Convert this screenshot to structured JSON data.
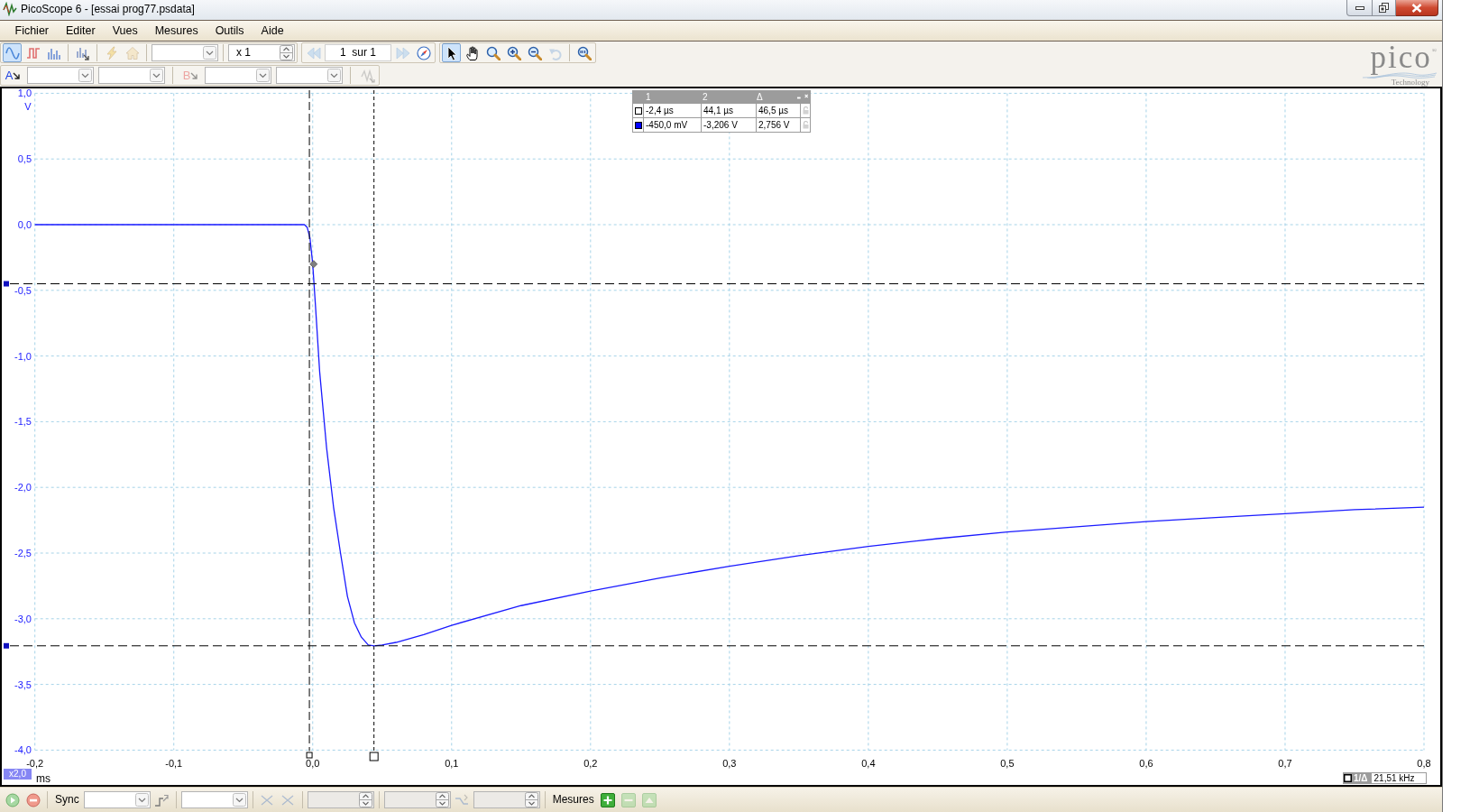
{
  "window": {
    "title": "PicoScope 6 - [essai prog77.psdata]"
  },
  "menu": [
    "Fichier",
    "Editer",
    "Vues",
    "Mesures",
    "Outils",
    "Aide"
  ],
  "toolbar_top": [
    [
      [
        {
          "kind": "button",
          "selected": true,
          "disabled": false
        },
        {
          "kind": "button",
          "selected": false,
          "disabled": false
        },
        {
          "kind": "button",
          "selected": false,
          "disabled": false
        }
      ],
      [
        {
          "kind": "button",
          "selected": false,
          "disabled": false
        }
      ],
      [
        {
          "kind": "button",
          "selected": false,
          "disabled": true
        },
        {
          "kind": "button",
          "selected": false,
          "disabled": true
        }
      ],
      [
        {
          "kind": "combo",
          "disabled": false
        }
      ],
      [
        {
          "kind": "spin",
          "value": "x 1",
          "disabled": false
        }
      ]
    ],
    [
      [
        {
          "kind": "button",
          "selected": false,
          "disabled": true
        },
        {
          "kind": "field",
          "value": "1  sur 1"
        },
        {
          "kind": "button",
          "selected": false,
          "disabled": true
        },
        {
          "kind": "button",
          "selected": false,
          "disabled": false
        }
      ]
    ],
    [
      [
        {
          "kind": "button",
          "selected": true,
          "disabled": false
        },
        {
          "kind": "button",
          "selected": false,
          "disabled": false
        },
        {
          "kind": "button",
          "selected": false,
          "disabled": false
        },
        {
          "kind": "button",
          "selected": false,
          "disabled": false
        },
        {
          "kind": "button",
          "selected": false,
          "disabled": false
        },
        {
          "kind": "button",
          "selected": false,
          "disabled": true
        }
      ],
      [
        {
          "kind": "button",
          "selected": false,
          "disabled": false
        }
      ]
    ]
  ],
  "toolbar_channels": [
    [
      {
        "kind": "channel",
        "label": "A",
        "disabled": false
      },
      {
        "kind": "combo",
        "disabled": false
      },
      {
        "kind": "combo",
        "disabled": false
      }
    ],
    [
      {
        "kind": "channel",
        "label": "B",
        "disabled": true
      },
      {
        "kind": "combo",
        "disabled": false
      },
      {
        "kind": "combo",
        "disabled": false
      }
    ],
    [
      {
        "kind": "button",
        "disabled": true
      }
    ]
  ],
  "logo": {
    "name": "pico$^{®}$",
    "tagline": "Technology"
  },
  "scope": {
    "chart_data": {
      "type": "line",
      "xlabel": "ms",
      "ylabel": "V",
      "grid": true,
      "x": [
        -0.2,
        -0.1,
        -0.006,
        -0.004,
        -0.002,
        0,
        0.002,
        0.005,
        0.01,
        0.015,
        0.02,
        0.025,
        0.03,
        0.035,
        0.04,
        0.044,
        0.05,
        0.06,
        0.08,
        0.1,
        0.15,
        0.2,
        0.25,
        0.3,
        0.35,
        0.4,
        0.45,
        0.5,
        0.55,
        0.6,
        0.65,
        0.7,
        0.75,
        0.8
      ],
      "series": [
        {
          "color": "#1a1aff",
          "values": [
            0,
            0,
            0,
            -0.02,
            -0.1,
            -0.3,
            -0.62,
            -1.12,
            -1.7,
            -2.15,
            -2.5,
            -2.83,
            -3.03,
            -3.14,
            -3.2,
            -3.206,
            -3.2,
            -3.18,
            -3.12,
            -3.05,
            -2.9,
            -2.79,
            -2.69,
            -2.6,
            -2.52,
            -2.45,
            -2.39,
            -2.34,
            -2.3,
            -2.26,
            -2.23,
            -2.2,
            -2.17,
            -2.15
          ]
        }
      ],
      "xlim": [
        -0.2,
        0.8
      ],
      "ylim": [
        -4,
        1
      ],
      "xticks": [
        {
          "value": -0.2,
          "label": "-0,2"
        },
        {
          "value": -0.1,
          "label": "-0,1"
        },
        {
          "value": 0,
          "label": "0,0"
        },
        {
          "value": 0.1,
          "label": "0,1"
        },
        {
          "value": 0.2,
          "label": "0,2"
        },
        {
          "value": 0.3,
          "label": "0,3"
        },
        {
          "value": 0.4,
          "label": "0,4"
        },
        {
          "value": 0.5,
          "label": "0,5"
        },
        {
          "value": 0.6,
          "label": "0,6"
        },
        {
          "value": 0.7,
          "label": "0,7"
        },
        {
          "value": 0.8,
          "label": "0,8"
        }
      ],
      "yticks": [
        {
          "value": 1,
          "label": "1,0"
        },
        {
          "value": 0.5,
          "label": "0,5"
        },
        {
          "value": 0,
          "label": "0,0"
        },
        {
          "value": -0.5,
          "label": "-0,5"
        },
        {
          "value": -1,
          "label": "-1,0"
        },
        {
          "value": -1.5,
          "label": "-1,5"
        },
        {
          "value": -2,
          "label": "-2,0"
        },
        {
          "value": -2.5,
          "label": "-2,5"
        },
        {
          "value": -3,
          "label": "-3,0"
        },
        {
          "value": -3.5,
          "label": "-3,5"
        },
        {
          "value": -4,
          "label": "-4,0"
        }
      ],
      "ref_lines": [
        {
          "axis": "x",
          "value": -0.0024
        },
        {
          "axis": "x",
          "value": 0.0441
        },
        {
          "axis": "y",
          "value": -0.45
        },
        {
          "axis": "y",
          "value": -3.206
        }
      ]
    },
    "zoom_label": "x2,0",
    "readout": {
      "label": "1/Δ",
      "value": "21,51 kHz"
    },
    "ruler_table": {
      "columns": [
        "1",
        "2",
        "Δ"
      ],
      "rows": [
        {
          "color": "#ffffff",
          "cells": [
            "-2,4 µs",
            "44,1 µs",
            "46,5 µs"
          ]
        },
        {
          "color": "#0000ff",
          "cells": [
            "-450,0 mV",
            "-3,206 V",
            "2,756 V"
          ]
        }
      ]
    }
  },
  "toolbar_bottom": [
    [
      {
        "kind": "button",
        "disabled": false
      },
      {
        "kind": "button",
        "disabled": false
      }
    ],
    [
      {
        "kind": "label",
        "text": "Sync"
      },
      {
        "kind": "combo",
        "disabled": false
      },
      {
        "kind": "button",
        "disabled": false
      }
    ],
    [
      {
        "kind": "combo",
        "disabled": false
      }
    ],
    [
      {
        "kind": "button",
        "disabled": true
      },
      {
        "kind": "button",
        "disabled": true
      }
    ],
    [
      {
        "kind": "spin",
        "disabled": true
      }
    ],
    [
      {
        "kind": "spin",
        "disabled": true
      },
      {
        "kind": "button",
        "disabled": true
      },
      {
        "kind": "spin",
        "disabled": true
      }
    ],
    [
      {
        "kind": "label",
        "text": "Mesures"
      },
      {
        "kind": "button",
        "disabled": false
      },
      {
        "kind": "button",
        "disabled": true
      },
      {
        "kind": "button",
        "disabled": true
      }
    ]
  ]
}
